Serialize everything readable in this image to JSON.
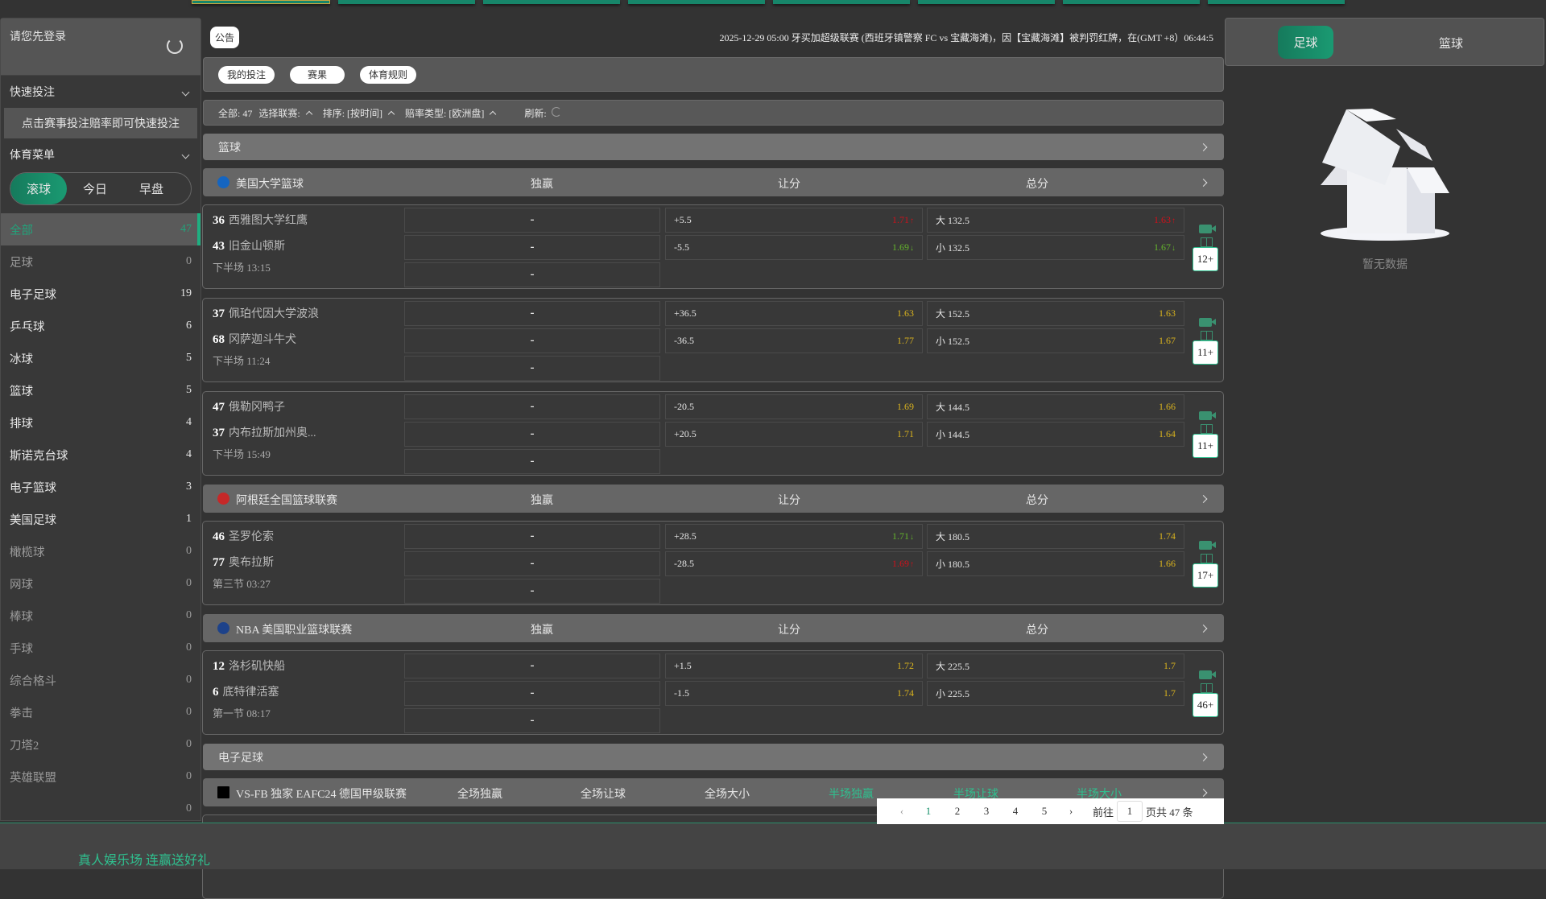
{
  "sidebar": {
    "login_prompt": "请您先登录",
    "quick_bet": {
      "title": "快速投注",
      "hint": "点击赛事投注赔率即可快速投注"
    },
    "sports_menu": {
      "title": "体育菜单",
      "tabs": [
        "滚球",
        "今日",
        "早盘"
      ],
      "active_tab": "滚球"
    },
    "sports": [
      {
        "name": "全部",
        "count": "47",
        "active": true
      },
      {
        "name": "足球",
        "count": "0"
      },
      {
        "name": "电子足球",
        "count": "19"
      },
      {
        "name": "乒乓球",
        "count": "6"
      },
      {
        "name": "冰球",
        "count": "5"
      },
      {
        "name": "篮球",
        "count": "5"
      },
      {
        "name": "排球",
        "count": "4"
      },
      {
        "name": "斯诺克台球",
        "count": "4"
      },
      {
        "name": "电子篮球",
        "count": "3"
      },
      {
        "name": "美国足球",
        "count": "1"
      },
      {
        "name": "橄榄球",
        "count": "0"
      },
      {
        "name": "网球",
        "count": "0"
      },
      {
        "name": "棒球",
        "count": "0"
      },
      {
        "name": "手球",
        "count": "0"
      },
      {
        "name": "综合格斗",
        "count": "0"
      },
      {
        "name": "拳击",
        "count": "0"
      },
      {
        "name": "刀塔2",
        "count": "0"
      },
      {
        "name": "英雄联盟",
        "count": "0"
      },
      {
        "name": "",
        "count": "0"
      }
    ]
  },
  "promo_banner": "真人娱乐场 连赢送好礼",
  "announcement": {
    "button": "公告",
    "text": "2025-12-29 05:00 牙买加超级联赛 (西班牙镇警察 FC vs 宝藏海滩)，因【宝藏海滩】被判罚红牌，在(GMT +8）06:44:5"
  },
  "nav_tabs": [
    "我的投注",
    "赛果",
    "体育规则"
  ],
  "filters": {
    "total": "全部: 47",
    "league": "选择联赛:",
    "sort": "排序: [按时间]",
    "odds_type": "赔率类型: [欧洲盘]",
    "refresh": "刷新:"
  },
  "sections": [
    {
      "type": "sport",
      "label": "篮球"
    },
    {
      "type": "league",
      "name": "美国大学篮球",
      "icon_color": "#1565c0",
      "cols": [
        "独赢",
        "让分",
        "总分"
      ],
      "matches": [
        {
          "home": {
            "score": "36",
            "name": "西雅图大学红鹰"
          },
          "away": {
            "score": "43",
            "name": "旧金山顿斯"
          },
          "period": "下半场 13:15",
          "moneyline": [
            "-",
            "-",
            "-"
          ],
          "spread": [
            {
              "line": "+5.5",
              "odds": "1.71",
              "trend": "up"
            },
            {
              "line": "-5.5",
              "odds": "1.69",
              "trend": "down"
            }
          ],
          "total": [
            {
              "line": "大 132.5",
              "odds": "1.63",
              "trend": "up"
            },
            {
              "line": "小 132.5",
              "odds": "1.67",
              "trend": "down"
            }
          ],
          "more": "12+"
        },
        {
          "home": {
            "score": "37",
            "name": "佩珀代因大学波浪"
          },
          "away": {
            "score": "68",
            "name": "冈萨迦斗牛犬"
          },
          "period": "下半场 11:24",
          "moneyline": [
            "-",
            "-",
            "-"
          ],
          "spread": [
            {
              "line": "+36.5",
              "odds": "1.63"
            },
            {
              "line": "-36.5",
              "odds": "1.77"
            }
          ],
          "total": [
            {
              "line": "大 152.5",
              "odds": "1.63"
            },
            {
              "line": "小 152.5",
              "odds": "1.67"
            }
          ],
          "more": "11+"
        },
        {
          "home": {
            "score": "47",
            "name": "俄勒冈鸭子"
          },
          "away": {
            "score": "37",
            "name": "内布拉斯加州奥..."
          },
          "period": "下半场 15:49",
          "moneyline": [
            "-",
            "-",
            "-"
          ],
          "spread": [
            {
              "line": "-20.5",
              "odds": "1.69"
            },
            {
              "line": "+20.5",
              "odds": "1.71"
            }
          ],
          "total": [
            {
              "line": "大 144.5",
              "odds": "1.66"
            },
            {
              "line": "小 144.5",
              "odds": "1.64"
            }
          ],
          "more": "11+"
        }
      ]
    },
    {
      "type": "league",
      "name": "阿根廷全国篮球联赛",
      "icon_color": "#c62828",
      "cols": [
        "独赢",
        "让分",
        "总分"
      ],
      "matches": [
        {
          "home": {
            "score": "46",
            "name": "圣罗伦索"
          },
          "away": {
            "score": "77",
            "name": "奥布拉斯"
          },
          "period": "第三节 03:27",
          "moneyline": [
            "-",
            "-",
            "-"
          ],
          "spread": [
            {
              "line": "+28.5",
              "odds": "1.71",
              "trend": "down"
            },
            {
              "line": "-28.5",
              "odds": "1.69",
              "trend": "up"
            }
          ],
          "total": [
            {
              "line": "大 180.5",
              "odds": "1.74"
            },
            {
              "line": "小 180.5",
              "odds": "1.66"
            }
          ],
          "more": "17+"
        }
      ]
    },
    {
      "type": "league",
      "name": "NBA 美国职业篮球联赛",
      "icon_color": "#1d428a",
      "cols": [
        "独赢",
        "让分",
        "总分"
      ],
      "matches": [
        {
          "home": {
            "score": "12",
            "name": "洛杉矶快船"
          },
          "away": {
            "score": "6",
            "name": "底特律活塞"
          },
          "period": "第一节 08:17",
          "moneyline": [
            "-",
            "-",
            "-"
          ],
          "spread": [
            {
              "line": "+1.5",
              "odds": "1.72"
            },
            {
              "line": "-1.5",
              "odds": "1.74"
            }
          ],
          "total": [
            {
              "line": "大 225.5",
              "odds": "1.7"
            },
            {
              "line": "小 225.5",
              "odds": "1.7"
            }
          ],
          "more": "46+"
        }
      ]
    },
    {
      "type": "sport",
      "label": "电子足球"
    },
    {
      "type": "league6",
      "name": "VS-FB 独家 EAFC24 德国甲级联赛",
      "icon_color": "#000000",
      "cols": [
        "全场独赢",
        "全场让球",
        "全场大小",
        "半场独赢",
        "半场让球",
        "半场大小"
      ],
      "matches": []
    }
  ],
  "pagination": {
    "pages": [
      "1",
      "2",
      "3",
      "4",
      "5"
    ],
    "current": "1",
    "goto_label": "前往",
    "goto_value": "1",
    "total": "页共 47 条"
  },
  "right_panel": {
    "tabs": [
      "足球",
      "篮球"
    ],
    "active": "足球",
    "empty_text": "暂无数据"
  },
  "colors": {
    "accent": "#1a9a72",
    "odds": "#d8b21e",
    "odds_up": "#d0101a",
    "odds_down": "#64b42c"
  }
}
